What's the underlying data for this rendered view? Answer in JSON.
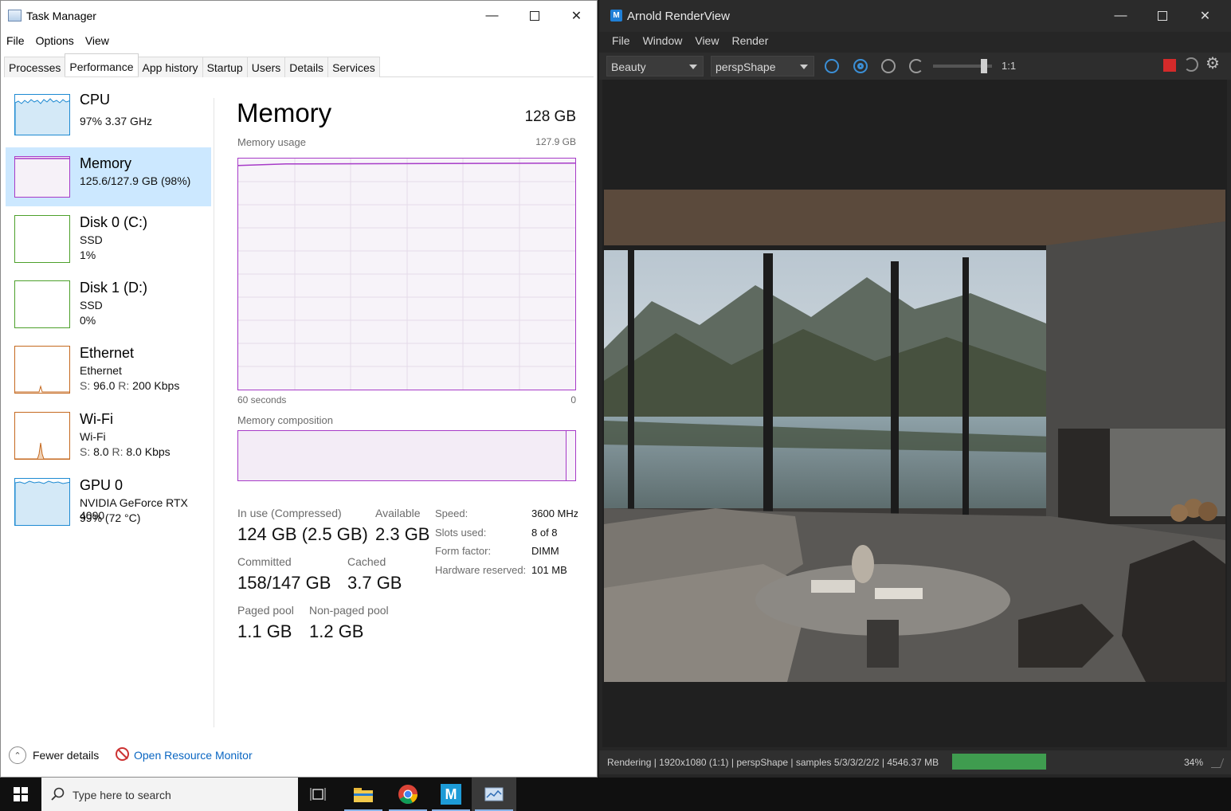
{
  "task_manager": {
    "title": "Task Manager",
    "menu": [
      "File",
      "Options",
      "View"
    ],
    "tabs": [
      "Processes",
      "Performance",
      "App history",
      "Startup",
      "Users",
      "Details",
      "Services"
    ],
    "active_tab": "Performance",
    "sidebar": [
      {
        "name": "CPU",
        "line1": "97% 3.37 GHz",
        "line2": "",
        "color": "#1e8ad2"
      },
      {
        "name": "Memory",
        "line1": "125.6/127.9 GB (98%)",
        "line2": "",
        "color": "#a73bc8"
      },
      {
        "name": "Disk 0 (C:)",
        "line1": "SSD",
        "line2": "1%",
        "color": "#4da02b"
      },
      {
        "name": "Disk 1 (D:)",
        "line1": "SSD",
        "line2": "0%",
        "color": "#4da02b"
      },
      {
        "name": "Ethernet",
        "line1": "Ethernet",
        "s_label": "S:",
        "s_val": "96.0",
        "r_label": "R:",
        "r_val": "200 Kbps",
        "color": "#c5691f"
      },
      {
        "name": "Wi-Fi",
        "line1": "Wi-Fi",
        "s_label": "S:",
        "s_val": "8.0",
        "r_label": "R:",
        "r_val": "8.0 Kbps",
        "color": "#c5691f"
      },
      {
        "name": "GPU 0",
        "line1": "NVIDIA GeForce RTX 4090",
        "line2": "99% (72 °C)",
        "color": "#1e8ad2"
      }
    ],
    "memory": {
      "title": "Memory",
      "total": "128 GB",
      "usage_label": "Memory usage",
      "usage_max": "127.9 GB",
      "axis_left": "60 seconds",
      "axis_right": "0",
      "usage_fraction": 0.98,
      "composition_label": "Memory composition",
      "in_use_label": "In use (Compressed)",
      "in_use_value": "124 GB (2.5 GB)",
      "available_label": "Available",
      "available_value": "2.3 GB",
      "committed_label": "Committed",
      "committed_value": "158/147 GB",
      "cached_label": "Cached",
      "cached_value": "3.7 GB",
      "paged_label": "Paged pool",
      "paged_value": "1.1 GB",
      "nonpaged_label": "Non-paged pool",
      "nonpaged_value": "1.2 GB",
      "speed_label": "Speed:",
      "speed_value": "3600 MHz",
      "slots_label": "Slots used:",
      "slots_value": "8 of 8",
      "form_label": "Form factor:",
      "form_value": "DIMM",
      "hwres_label": "Hardware reserved:",
      "hwres_value": "101 MB"
    },
    "footer": {
      "fewer": "Fewer details",
      "resmon": "Open Resource Monitor"
    }
  },
  "renderview": {
    "title": "Arnold RenderView",
    "icon_letter": "M",
    "menu": [
      "File",
      "Window",
      "View",
      "Render"
    ],
    "aov": "Beauty",
    "camera": "perspShape",
    "zoom": "1:1",
    "status": "Rendering | 1920x1080 (1:1) | perspShape | samples 5/3/3/2/2/2 | 4546.37 MB",
    "progress_percent": 34,
    "progress_label": "34%"
  },
  "taskbar": {
    "search_placeholder": "Type here to search"
  },
  "colors": {
    "memory_accent": "#a73bc8",
    "selection": "#cce8ff",
    "link": "#0a66c2",
    "stop_button": "#d42a2a",
    "progress": "#3f9c4f"
  }
}
